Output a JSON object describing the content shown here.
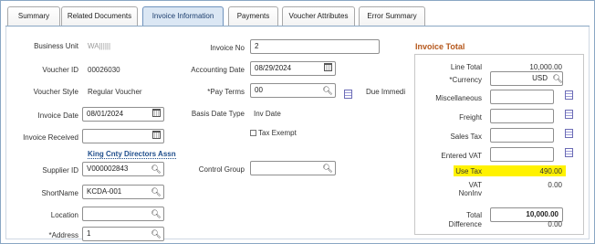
{
  "tabs": [
    "Summary",
    "Related Documents",
    "Invoice Information",
    "Payments",
    "Voucher Attributes",
    "Error Summary"
  ],
  "left": {
    "business_unit_label": "Business Unit",
    "business_unit_value": "WA||||||",
    "voucher_id_label": "Voucher ID",
    "voucher_id_value": "00026030",
    "voucher_style_label": "Voucher Style",
    "voucher_style_value": "Regular Voucher",
    "invoice_date_label": "Invoice Date",
    "invoice_date_value": "08/01/2024",
    "invoice_received_label": "Invoice Received",
    "invoice_received_value": "",
    "supplier_name_link": "King Cnty Directors Assn",
    "supplier_id_label": "Supplier ID",
    "supplier_id_value": "V000002843",
    "shortname_label": "ShortName",
    "shortname_value": "KCDA-001",
    "location_label": "Location",
    "location_value": "",
    "address_label": "*Address",
    "address_value": "1"
  },
  "middle": {
    "invoice_no_label": "Invoice No",
    "invoice_no_value": "2",
    "accounting_date_label": "Accounting Date",
    "accounting_date_value": "08/29/2024",
    "pay_terms_label": "*Pay Terms",
    "pay_terms_value": "00",
    "pay_terms_desc": "Due Immedi",
    "basis_date_type_label": "Basis Date Type",
    "basis_date_type_value": "Inv Date",
    "tax_exempt_label": "Tax Exempt",
    "control_group_label": "Control Group",
    "control_group_value": ""
  },
  "totals": {
    "title": "Invoice Total",
    "line_total_label": "Line Total",
    "line_total_value": "10,000.00",
    "currency_label": "*Currency",
    "currency_value": "USD",
    "miscellaneous_label": "Miscellaneous",
    "freight_label": "Freight",
    "sales_tax_label": "Sales Tax",
    "entered_vat_label": "Entered VAT",
    "use_tax_label": "Use Tax",
    "use_tax_value": "490.00",
    "vat_label": "VAT",
    "vat_value": "0.00",
    "noninv_label": "NonInv",
    "total_label": "Total",
    "total_value": "10,000.00",
    "difference_label": "Difference",
    "difference_value": "0.00",
    "highlight_color": "#fff200"
  },
  "icons": {
    "search": "search-icon",
    "calendar": "calendar-icon",
    "calculator": "calculator-icon"
  }
}
